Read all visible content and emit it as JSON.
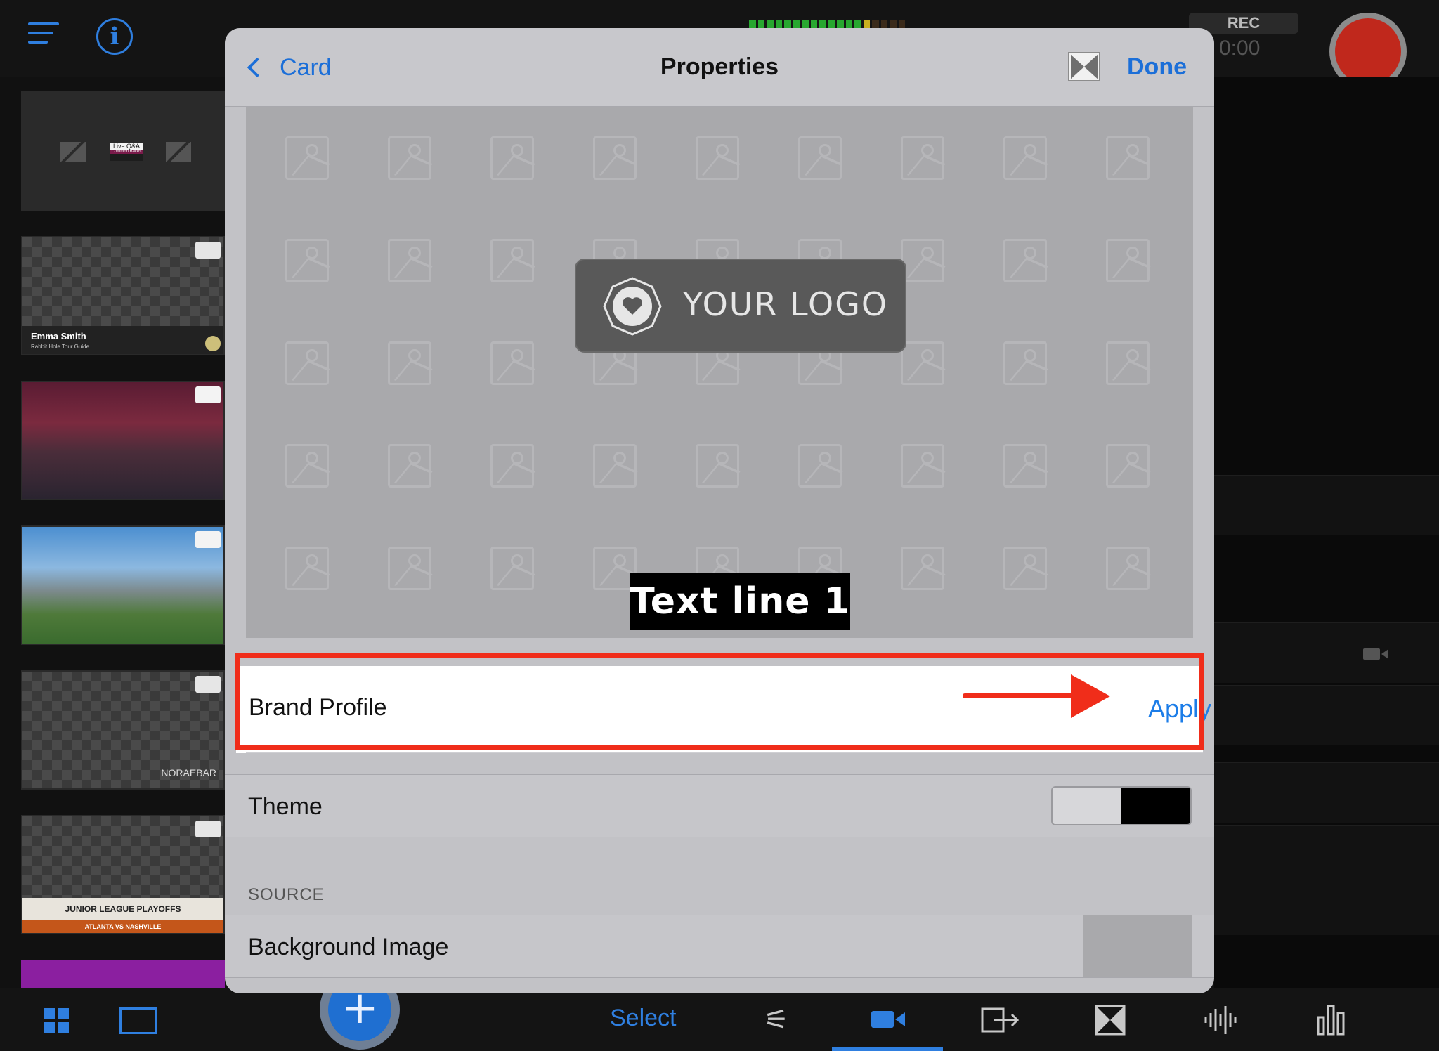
{
  "background": {
    "thumbnails": [
      {
        "type": "live-qa",
        "title": "Live Q&A",
        "subtitle": "Common Bakes"
      },
      {
        "type": "lower-third",
        "title": "Emma Smith",
        "subtitle": "Rabbit Hole Tour Guide"
      },
      {
        "type": "photo-concert"
      },
      {
        "type": "photo-city"
      },
      {
        "type": "logo-overlay",
        "title": "NORAEBAR"
      },
      {
        "type": "scoreboard",
        "title": "JUNIOR LEAGUE PLAYOFFS",
        "subtitle": "ATLANTA VS NASHVILLE"
      }
    ],
    "rec_label": "REC",
    "rec_time": "0:00",
    "toolbar": {
      "select_label": "Select",
      "icons": [
        "sliders-icon",
        "camera-icon",
        "output-icon",
        "transition-icon",
        "audio-icon",
        "stats-icon"
      ]
    },
    "colors": {
      "accent": "#2f7fe0",
      "record": "#c0281c"
    }
  },
  "modal": {
    "back_label": "Card",
    "title": "Properties",
    "done_label": "Done",
    "preview": {
      "logo_text": "YOUR LOGO",
      "text_line": "Text line 1"
    },
    "brand_profile": {
      "label": "Brand Profile",
      "action": "Apply"
    },
    "theme": {
      "label": "Theme",
      "options": [
        "light",
        "dark"
      ]
    },
    "source_header": "SOURCE",
    "background_image": {
      "label": "Background Image"
    },
    "colors": {
      "link": "#1c6fd8",
      "annotation": "#f02d1a"
    }
  }
}
